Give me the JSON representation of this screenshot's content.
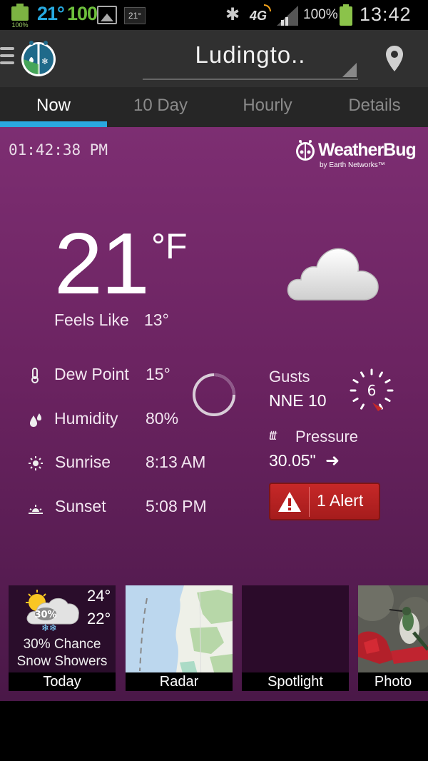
{
  "status_bar": {
    "battery_small_pct": "100%",
    "temp": "21°",
    "value": "100",
    "temp_small": "21°",
    "network": "4G",
    "battery_pct": "100%",
    "clock": "13:42"
  },
  "app_bar": {
    "location": "Ludingto.."
  },
  "tabs": [
    {
      "label": "Now"
    },
    {
      "label": "10 Day"
    },
    {
      "label": "Hourly"
    },
    {
      "label": "Details"
    }
  ],
  "current": {
    "time": "01:42:38 PM",
    "brand": "WeatherBug",
    "brand_sub": "by Earth Networks™",
    "temperature": "21",
    "unit": "°F",
    "feels_like_label": "Feels Like",
    "feels_like_value": "13°",
    "dew_point_label": "Dew Point",
    "dew_point_value": "15°",
    "humidity_label": "Humidity",
    "humidity_value": "80%",
    "sunrise_label": "Sunrise",
    "sunrise_value": "8:13 AM",
    "sunset_label": "Sunset",
    "sunset_value": "5:08 PM",
    "gusts_label": "Gusts",
    "gusts_value": "NNE 10",
    "wind_compass_value": "6",
    "pressure_label": "Pressure",
    "pressure_value": "30.05\"",
    "alert_label": "1 Alert"
  },
  "tiles": {
    "today": {
      "caption": "Today",
      "high": "24°",
      "low": "22°",
      "precip": "30%",
      "desc_line1": "30% Chance",
      "desc_line2": "Snow Showers"
    },
    "radar": {
      "caption": "Radar"
    },
    "spotlight": {
      "caption": "Spotlight"
    },
    "photo": {
      "caption": "Photo"
    }
  },
  "colors": {
    "accent": "#2aa8e0",
    "alert": "#c62828",
    "background_top": "#7d2e72",
    "background_bottom": "#4a1848"
  }
}
